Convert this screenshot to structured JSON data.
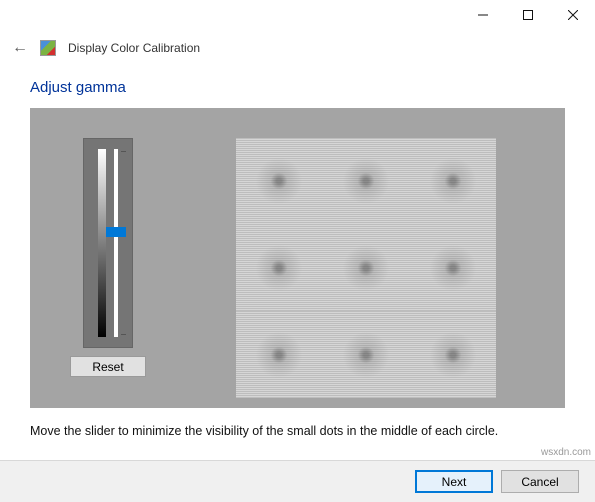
{
  "window": {
    "title": "Display Color Calibration"
  },
  "page": {
    "heading": "Adjust gamma",
    "instruction": "Move the slider to minimize the visibility of the small dots in the middle of each circle."
  },
  "controls": {
    "reset": "Reset",
    "next": "Next",
    "cancel": "Cancel"
  },
  "slider": {
    "value": 50,
    "min": 0,
    "max": 100
  },
  "watermark": "wsxdn.com"
}
